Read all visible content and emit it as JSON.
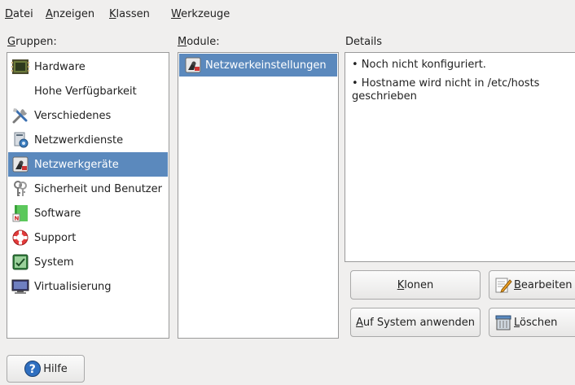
{
  "menu": {
    "datei": {
      "underline": "D",
      "rest": "atei"
    },
    "anzeigen": {
      "underline": "A",
      "rest": "nzeigen"
    },
    "klassen": {
      "underline": "K",
      "rest": "lassen"
    },
    "werkzeuge": {
      "underline": "W",
      "rest": "erkzeuge"
    }
  },
  "labels": {
    "gruppen": {
      "underline": "G",
      "rest": "ruppen:"
    },
    "module": {
      "underline": "M",
      "rest": "odule:"
    },
    "details": "Details"
  },
  "groups": [
    {
      "label": "Hardware",
      "icon": "hardware-icon"
    },
    {
      "label": "Hohe Verfügbarkeit",
      "icon": ""
    },
    {
      "label": "Verschiedenes",
      "icon": "tools-icon"
    },
    {
      "label": "Netzwerkdienste",
      "icon": "network-services-icon"
    },
    {
      "label": "Netzwerkgeräte",
      "icon": "network-card-icon",
      "selected": true
    },
    {
      "label": "Sicherheit und Benutzer",
      "icon": "security-keys-icon"
    },
    {
      "label": "Software",
      "icon": "software-icon"
    },
    {
      "label": "Support",
      "icon": "lifebuoy-icon"
    },
    {
      "label": "System",
      "icon": "system-icon"
    },
    {
      "label": "Virtualisierung",
      "icon": "monitor-icon"
    }
  ],
  "modules": [
    {
      "label": "Netzwerkeinstellungen",
      "icon": "network-card-icon",
      "selected": true
    }
  ],
  "details": [
    "• Noch nicht konfiguriert.",
    "• Hostname wird nicht in /etc/hosts geschrieben"
  ],
  "buttons": {
    "klonen": {
      "underline": "K",
      "rest": "lonen"
    },
    "bearbeiten": {
      "underline": "B",
      "rest": "earbeiten"
    },
    "auf_system": {
      "underline": "A",
      "rest": "uf System anwenden"
    },
    "loeschen": {
      "underline": "L",
      "rest": "öschen"
    },
    "hilfe": "Hilfe"
  },
  "colors": {
    "selection": "#5b89bd",
    "background": "#f0efee"
  }
}
